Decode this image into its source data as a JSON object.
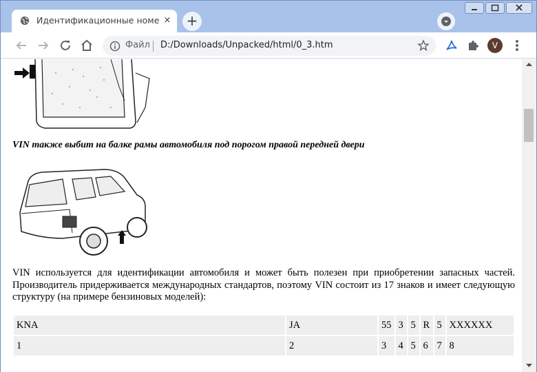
{
  "browser": {
    "tab_title": "Идентификационные номера и",
    "tab_close": "×",
    "new_tab": "+",
    "omnibox_label": "Файл",
    "url": "D:/Downloads/Unpacked/html/0_3.htm",
    "avatar_letter": "V",
    "colors": {
      "titlebar": "#a9c2e9",
      "avatar": "#5d3b31",
      "extension_accent": "#2f6fd6"
    },
    "icons": [
      "globe-icon",
      "back-arrow-icon",
      "forward-arrow-icon",
      "reload-icon",
      "home-icon",
      "info-icon",
      "star-icon",
      "acrobat-icon",
      "puzzle-icon",
      "kebab-menu-icon"
    ]
  },
  "page": {
    "caption": "VIN также выбит на балке рамы автомобиля под порогом правой передней двери",
    "paragraph": "VIN используется для идентификации автомобиля и может быть полезен при приобретении запасных частей. Производитель придерживается международных стандартов, поэтому VIN состоит из 17 знаков и имеет следующую структуру (на примере бензиновых моделей):",
    "vin_table": {
      "rows": [
        [
          "KNA",
          "JA",
          "55",
          "3",
          "5",
          "R",
          "5",
          "XXXXXX"
        ],
        [
          "1",
          "2",
          "3",
          "4",
          "5",
          "6",
          "7",
          "8"
        ]
      ]
    }
  }
}
